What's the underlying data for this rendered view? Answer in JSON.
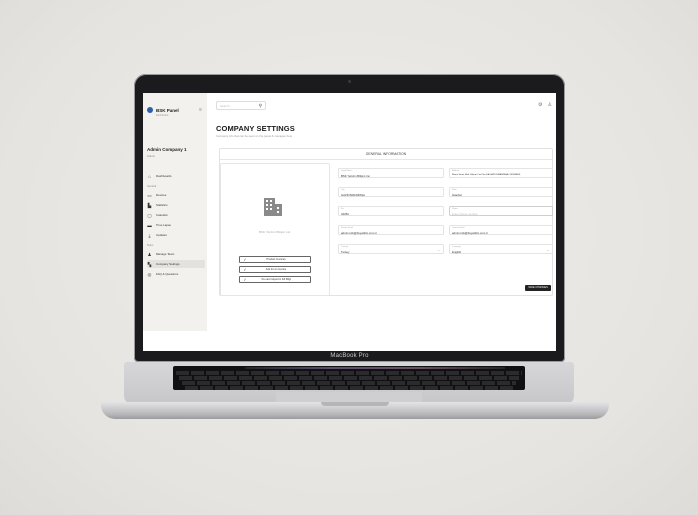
{
  "device": {
    "brand_label": "MacBook Pro"
  },
  "sidebar": {
    "app_name": "BSK Panel",
    "app_sub": "Dashboard",
    "company_name": "Admin Company 1",
    "company_role": "Admin",
    "sections": {
      "general": "General",
      "team": "Team"
    },
    "items": [
      {
        "label": "Dashboards",
        "icon": "home-icon"
      },
      {
        "label": "Devices",
        "icon": "monitor-icon"
      },
      {
        "label": "Statistics",
        "icon": "bar-chart-icon"
      },
      {
        "label": "Calendar",
        "icon": "calendar-icon"
      },
      {
        "label": "Time Lapse",
        "icon": "film-icon"
      },
      {
        "label": "Updates",
        "icon": "download-icon"
      },
      {
        "label": "Manage Team",
        "icon": "team-icon"
      },
      {
        "label": "Company Settings",
        "icon": "settings-icon"
      },
      {
        "label": "FAQ & Questions",
        "icon": "help-icon"
      }
    ]
  },
  "header": {
    "search_placeholder": "Search"
  },
  "page": {
    "title": "COMPANY SETTINGS",
    "subtitle": "Company info that can be seen on the panel & manages here",
    "section_title": "GENERAL INFORMATION"
  },
  "logo_card": {
    "placeholder": "BSK Yazılım Bilişim Ltd.",
    "checks": [
      "Product Invoices",
      "Ask for an invoice",
      "You are helped in full Bilgi"
    ]
  },
  "form": {
    "fields": [
      {
        "label": "Legal Name",
        "value": "BSK Yazılım Bilişim Inc."
      },
      {
        "label": "Address",
        "value": "Mimar Sinan Mah. Bilişim Cad. No:1/A GAZİOSMANPAŞA / İSTANBUL"
      },
      {
        "label": "City",
        "value": "GAZİOSMANPAŞA"
      },
      {
        "label": "State",
        "value": "İstanbul"
      },
      {
        "label": "Zip",
        "value": "34250"
      },
      {
        "label": "Phone",
        "placeholder": "Enter phone number"
      },
      {
        "label": "Sender Email",
        "value": "admin.info@bsyazilim.com.tr"
      },
      {
        "label": "Contact Email",
        "value": "admin.info@bsyazilim.com.tr"
      },
      {
        "label": "Country",
        "value": "Turkey"
      },
      {
        "label": "Language",
        "value": "English"
      }
    ],
    "save_label": "SAVE CHANGES"
  }
}
